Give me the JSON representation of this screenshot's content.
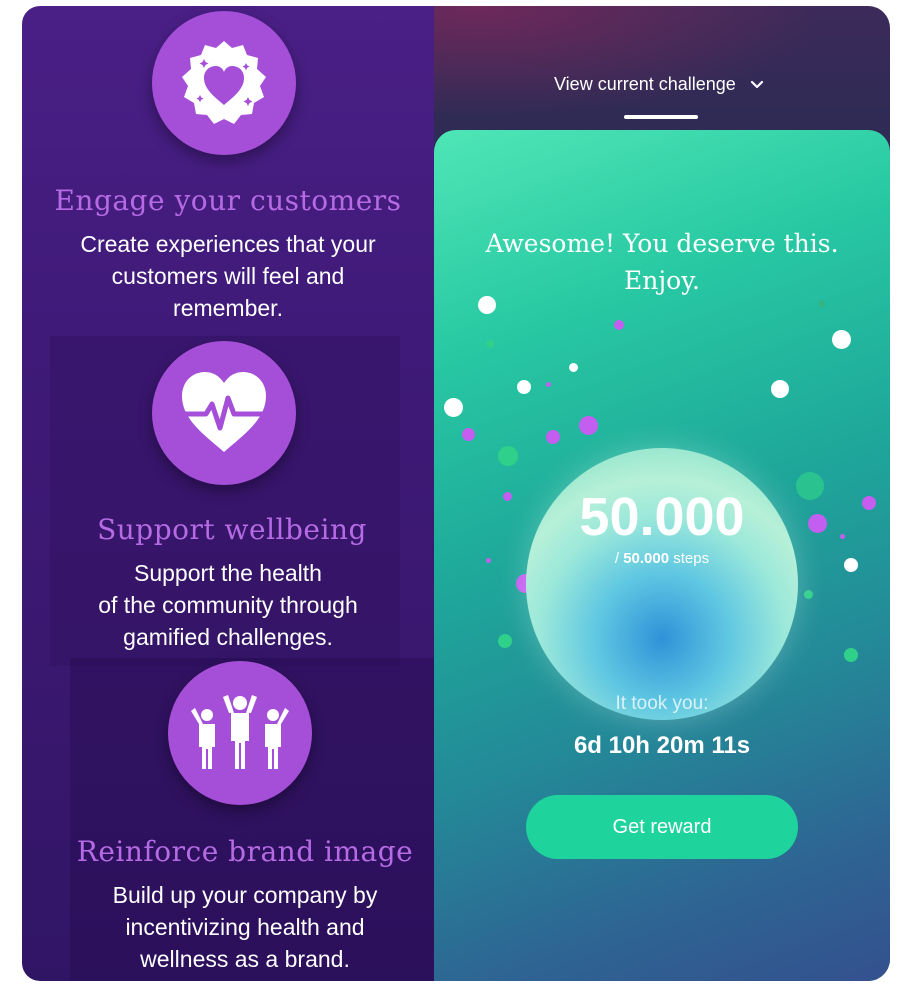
{
  "features": [
    {
      "icon": "heart-badge-icon",
      "title": "Engage your customers",
      "lines": [
        "Create experiences that your",
        "customers will feel and",
        "remember."
      ]
    },
    {
      "icon": "heartbeat-icon",
      "title": "Support wellbeing",
      "lines": [
        "Support the health",
        "of the community through",
        "gamified challenges."
      ]
    },
    {
      "icon": "team-celebrating-icon",
      "title": "Reinforce brand image",
      "lines": [
        "Build up your company by",
        "incentivizing health and",
        "wellness as a brand."
      ]
    }
  ],
  "phone": {
    "header_label": "View current challenge",
    "header_icon": "chevron-down-icon",
    "card_title_line1": "Awesome! You deserve this.",
    "card_title_line2": "Enjoy.",
    "steps_value": "50.000",
    "steps_sub_prefix": "/ ",
    "steps_goal": "50.000",
    "steps_unit": " steps",
    "took_label": "It took you:",
    "took_value": "6d 10h 20m 11s",
    "reward_button": "Get reward"
  },
  "colors": {
    "accent_purple": "#a54fd8",
    "title_purple": "#b66be4",
    "button_green": "#1ed49c"
  }
}
